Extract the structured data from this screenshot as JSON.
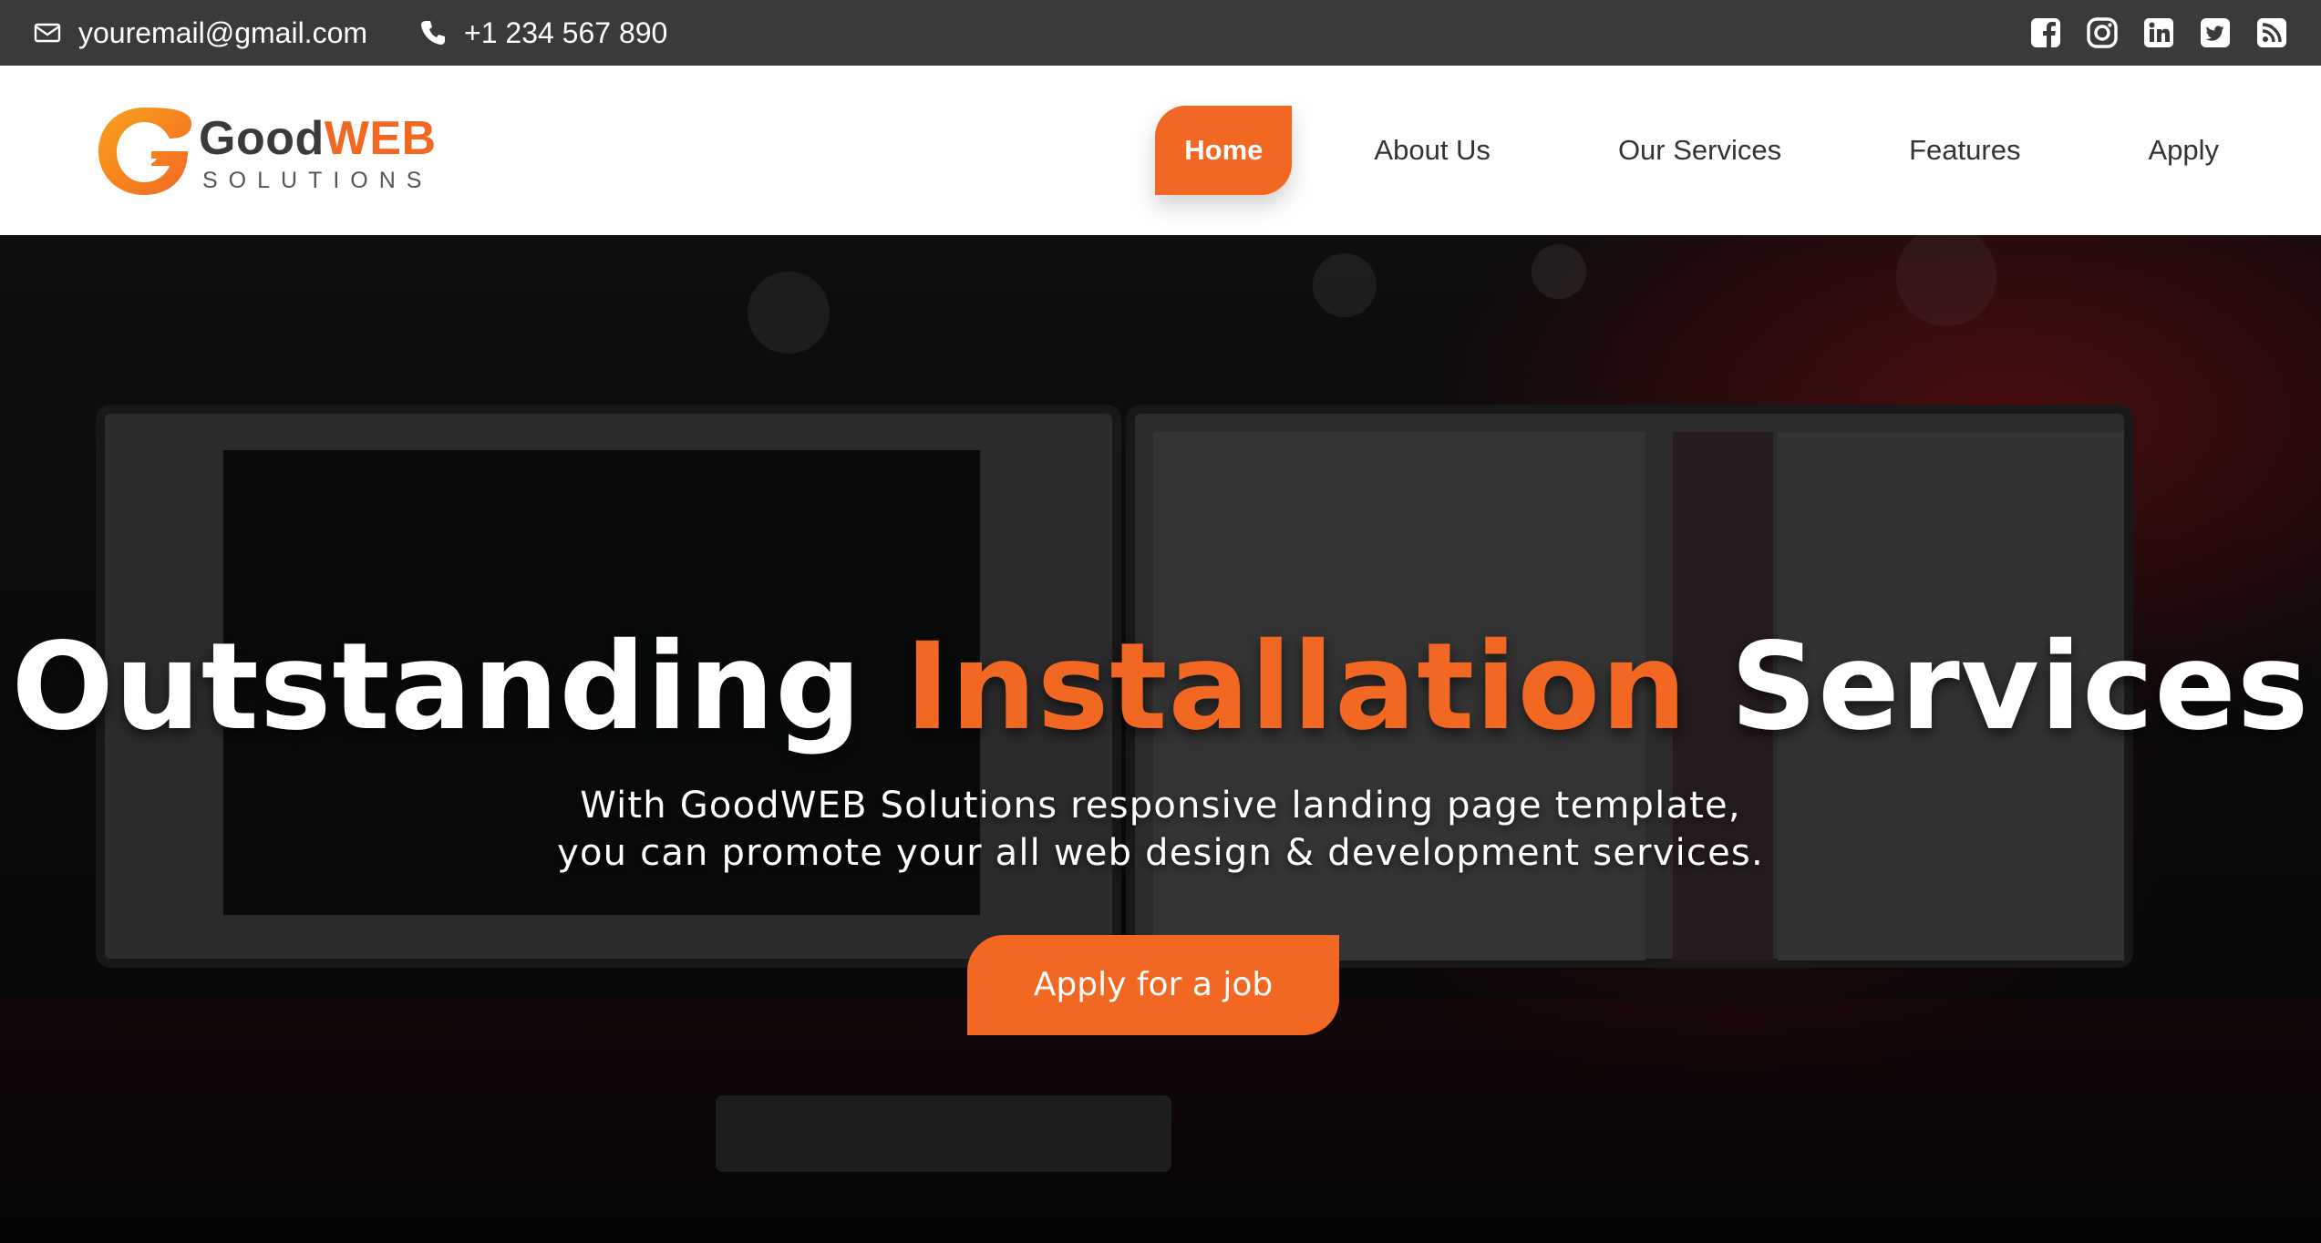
{
  "topbar": {
    "email": "youremail@gmail.com",
    "phone": "+1 234 567 890",
    "social": [
      "facebook-icon",
      "instagram-icon",
      "linkedin-icon",
      "twitter-icon",
      "rss-icon"
    ]
  },
  "logo": {
    "brand_primary": "Good",
    "brand_accent": "WEB",
    "tagline": "SOLUTIONS"
  },
  "nav": {
    "items": [
      {
        "label": "Home",
        "active": true
      },
      {
        "label": "About Us"
      },
      {
        "label": "Our Services"
      },
      {
        "label": "Features"
      },
      {
        "label": "Apply"
      }
    ]
  },
  "hero": {
    "title_part1": "Outstanding",
    "title_accent": "Installation",
    "title_part2": "Services",
    "subtitle_line1": "With GoodWEB Solutions responsive landing page template,",
    "subtitle_line2": "you can promote your all web design & development services.",
    "cta_label": "Apply for a job"
  },
  "colors": {
    "accent": "#f26722",
    "topbar_bg": "#3a3a3a",
    "header_bg": "#ffffff",
    "text_dark": "#333333"
  }
}
